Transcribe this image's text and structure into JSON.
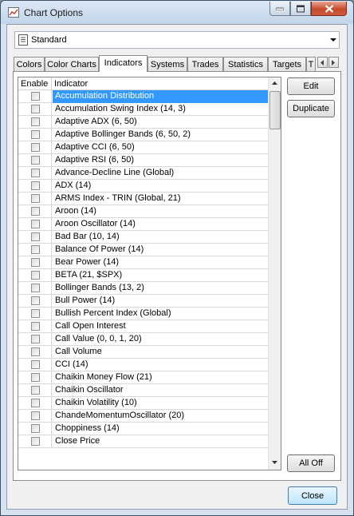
{
  "window": {
    "title": "Chart Options"
  },
  "profile_combo": {
    "value": "Standard"
  },
  "tabs": [
    {
      "label": "Colors"
    },
    {
      "label": "Color Charts"
    },
    {
      "label": "Indicators"
    },
    {
      "label": "Systems"
    },
    {
      "label": "Trades"
    },
    {
      "label": "Statistics"
    },
    {
      "label": "Targets"
    },
    {
      "label": "T"
    }
  ],
  "active_tab": "Indicators",
  "grid": {
    "columns": {
      "enable": "Enable",
      "indicator": "Indicator"
    },
    "rows": [
      {
        "name": "Accumulation Distribution",
        "enabled": false,
        "selected": true
      },
      {
        "name": "Accumulation Swing Index (14, 3)",
        "enabled": false
      },
      {
        "name": "Adaptive ADX (6, 50)",
        "enabled": false
      },
      {
        "name": "Adaptive Bollinger Bands (6, 50, 2)",
        "enabled": false
      },
      {
        "name": "Adaptive CCI (6, 50)",
        "enabled": false
      },
      {
        "name": "Adaptive RSI (6, 50)",
        "enabled": false
      },
      {
        "name": "Advance-Decline Line (Global)",
        "enabled": false
      },
      {
        "name": "ADX (14)",
        "enabled": false
      },
      {
        "name": "ARMS Index - TRIN (Global, 21)",
        "enabled": false
      },
      {
        "name": "Aroon (14)",
        "enabled": false
      },
      {
        "name": "Aroon Oscillator (14)",
        "enabled": false
      },
      {
        "name": "Bad Bar (10, 14)",
        "enabled": false
      },
      {
        "name": "Balance Of Power (14)",
        "enabled": false
      },
      {
        "name": "Bear Power (14)",
        "enabled": false
      },
      {
        "name": "BETA (21, $SPX)",
        "enabled": false
      },
      {
        "name": "Bollinger Bands (13, 2)",
        "enabled": false
      },
      {
        "name": "Bull Power (14)",
        "enabled": false
      },
      {
        "name": "Bullish Percent Index (Global)",
        "enabled": false
      },
      {
        "name": "Call Open Interest",
        "enabled": false
      },
      {
        "name": "Call Value (0, 0, 1, 20)",
        "enabled": false
      },
      {
        "name": "Call Volume",
        "enabled": false
      },
      {
        "name": "CCI (14)",
        "enabled": false
      },
      {
        "name": "Chaikin Money Flow (21)",
        "enabled": false
      },
      {
        "name": "Chaikin Oscillator",
        "enabled": false
      },
      {
        "name": "Chaikin Volatility (10)",
        "enabled": false
      },
      {
        "name": "ChandeMomentumOscillator (20)",
        "enabled": false
      },
      {
        "name": "Choppiness (14)",
        "enabled": false
      },
      {
        "name": "Close Price",
        "enabled": false
      }
    ]
  },
  "buttons": {
    "edit": "Edit",
    "duplicate": "Duplicate",
    "all_off": "All Off",
    "close": "Close"
  },
  "colors": {
    "selection": "#3399ff",
    "close_caption": "#c74a2c"
  }
}
